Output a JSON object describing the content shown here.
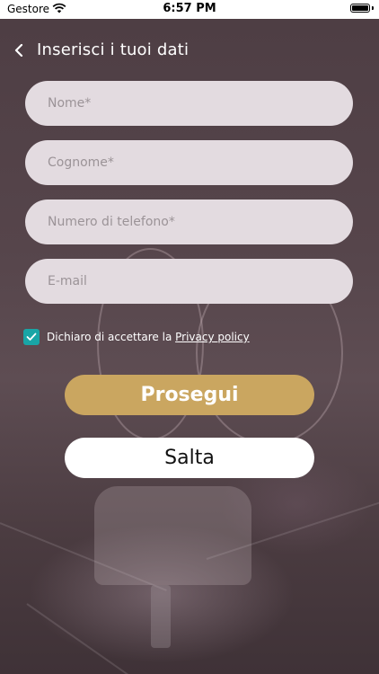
{
  "status_bar": {
    "carrier": "Gestore",
    "time": "6:57 PM"
  },
  "header": {
    "title": "Inserisci i tuoi dati",
    "back_icon": "chevron-left-icon"
  },
  "form": {
    "first_name_placeholder": "Nome*",
    "last_name_placeholder": "Cognome*",
    "phone_placeholder": "Numero di telefono*",
    "email_placeholder": "E-mail"
  },
  "consent": {
    "checked": true,
    "text": "Dichiaro di accettare la ",
    "link": "Privacy policy",
    "check_color": "#19a5a6"
  },
  "buttons": {
    "continue_label": "Prosegui",
    "skip_label": "Salta"
  },
  "colors": {
    "accent": "#caa660",
    "field_bg": "#e3dbe0"
  }
}
